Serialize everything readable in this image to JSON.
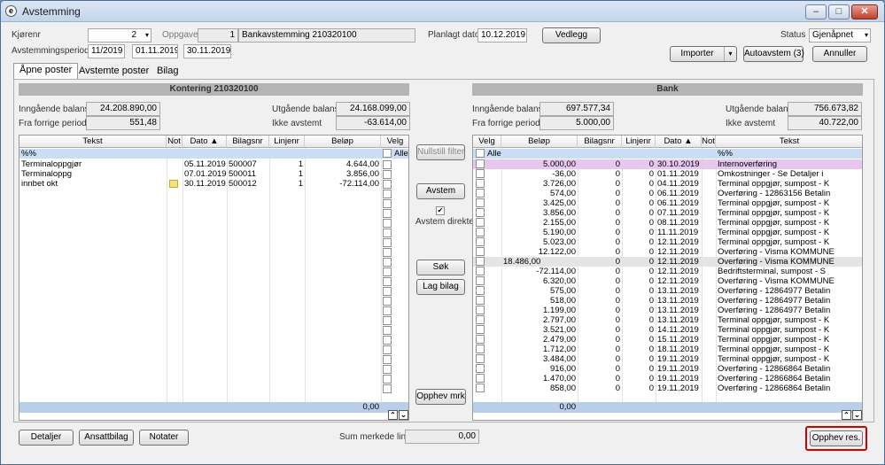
{
  "window": {
    "title": "Avstemming",
    "min": "–",
    "max": "□",
    "close": "✕"
  },
  "header": {
    "kjorenr_label": "Kjørenr",
    "kjorenr_value": "2",
    "oppgave_label": "Oppgave",
    "oppgave_num": "1",
    "oppgave_name": "Bankavstemming 210320100",
    "planlagt_label": "Planlagt dato",
    "planlagt_value": "10.12.2019",
    "vedlegg_button": "Vedlegg",
    "status_label": "Status",
    "status_value": "Gjenåpnet",
    "periode_label": "Avstemmingsperiode",
    "periode_value": "11/2019",
    "periode_from": "01.11.2019",
    "periode_to": "30.11.2019",
    "importer_button": "Importer",
    "autoavstem_button": "Autoavstem (3)",
    "annuller_button": "Annuller"
  },
  "tabs": [
    "Åpne poster",
    "Avstemte poster",
    "Bilag"
  ],
  "left": {
    "title": "Kontering 210320100",
    "ingaende_label": "Inngående balanse",
    "ingaende_value": "24.208.890,00",
    "utgaende_label": "Utgående balanse",
    "utgaende_value": "24.168.099,00",
    "forrige_label": "Fra forrige periode",
    "forrige_value": "551,48",
    "ikke_label": "Ikke avstemt",
    "ikke_value": "-63.614,00",
    "columns": [
      "Tekst",
      "Not",
      "Dato",
      "Bilagsnr",
      "Linjenr",
      "Beløp",
      "Velg"
    ],
    "filter": "%%",
    "alle": "Alle",
    "rows": [
      {
        "tekst": "Terminaloppgjør",
        "not": "",
        "dato": "05.11.2019",
        "bilagsnr": "500007",
        "linjenr": "1",
        "belop": "4.644,00"
      },
      {
        "tekst": "Terminaloppg",
        "not": "",
        "dato": "07.01.2019",
        "bilagsnr": "500011",
        "linjenr": "1",
        "belop": "3.856,00"
      },
      {
        "tekst": "innbet okt",
        "not": "note",
        "dato": "30.11.2019",
        "bilagsnr": "500012",
        "linjenr": "1",
        "belop": "-72.114,00"
      }
    ],
    "footer_sum": "0,00"
  },
  "middle": {
    "nullstill": "Nullstill filter",
    "avstem": "Avstem",
    "avstem_direkte": "Avstem direkte",
    "sok": "Søk",
    "lag_bilag": "Lag bilag",
    "opphev_mrk": "Opphev mrk"
  },
  "right": {
    "title": "Bank",
    "ingaende_label": "Inngående balanse",
    "ingaende_value": "697.577,34",
    "utgaende_label": "Utgående balanse",
    "utgaende_value": "756.673,82",
    "forrige_label": "Fra forrige periode",
    "forrige_value": "5.000,00",
    "ikke_label": "Ikke avstemt",
    "ikke_value": "40.722,00",
    "columns": [
      "Velg",
      "Beløp",
      "Bilagsnr",
      "Linjenr",
      "Dato",
      "Not",
      "Tekst"
    ],
    "filter": "%%",
    "alle": "Alle",
    "rows": [
      {
        "belop": "5.000,00",
        "bilagsnr": "0",
        "linjenr": "0",
        "dato": "30.10.2019",
        "tekst": "Internoverføring"
      },
      {
        "belop": "-36,00",
        "bilagsnr": "0",
        "linjenr": "0",
        "dato": "01.11.2019",
        "tekst": "Omkostninger - Se Detaljer i"
      },
      {
        "belop": "3.726,00",
        "bilagsnr": "0",
        "linjenr": "0",
        "dato": "04.11.2019",
        "tekst": "Terminal oppgjør, sumpost - K"
      },
      {
        "belop": "574,00",
        "bilagsnr": "0",
        "linjenr": "0",
        "dato": "06.11.2019",
        "tekst": "Overføring - 12863156 Betalin"
      },
      {
        "belop": "3.425,00",
        "bilagsnr": "0",
        "linjenr": "0",
        "dato": "06.11.2019",
        "tekst": "Terminal oppgjør, sumpost - K"
      },
      {
        "belop": "3.856,00",
        "bilagsnr": "0",
        "linjenr": "0",
        "dato": "07.11.2019",
        "tekst": "Terminal oppgjør, sumpost - K"
      },
      {
        "belop": "2.155,00",
        "bilagsnr": "0",
        "linjenr": "0",
        "dato": "08.11.2019",
        "tekst": "Terminal oppgjør, sumpost - K"
      },
      {
        "belop": "5.190,00",
        "bilagsnr": "0",
        "linjenr": "0",
        "dato": "11.11.2019",
        "tekst": "Terminal oppgjør, sumpost - K"
      },
      {
        "belop": "5.023,00",
        "bilagsnr": "0",
        "linjenr": "0",
        "dato": "12.11.2019",
        "tekst": "Terminal oppgjør, sumpost - K"
      },
      {
        "belop": "12.122,00",
        "bilagsnr": "0",
        "linjenr": "0",
        "dato": "12.11.2019",
        "tekst": "Overføring - Visma KOMMUNE"
      },
      {
        "belop": "18.486,00",
        "bilagsnr": "0",
        "linjenr": "0",
        "dato": "12.11.2019",
        "tekst": "Overføring - Visma KOMMUNE"
      },
      {
        "belop": "-72.114,00",
        "bilagsnr": "0",
        "linjenr": "0",
        "dato": "12.11.2019",
        "tekst": "Bedriftsterminal, sumpost - S"
      },
      {
        "belop": "6.320,00",
        "bilagsnr": "0",
        "linjenr": "0",
        "dato": "12.11.2019",
        "tekst": "Overføring - Visma KOMMUNE"
      },
      {
        "belop": "575,00",
        "bilagsnr": "0",
        "linjenr": "0",
        "dato": "13.11.2019",
        "tekst": "Overføring - 12864977 Betalin"
      },
      {
        "belop": "518,00",
        "bilagsnr": "0",
        "linjenr": "0",
        "dato": "13.11.2019",
        "tekst": "Overføring - 12864977 Betalin"
      },
      {
        "belop": "1.199,00",
        "bilagsnr": "0",
        "linjenr": "0",
        "dato": "13.11.2019",
        "tekst": "Overføring - 12864977 Betalin"
      },
      {
        "belop": "2.797,00",
        "bilagsnr": "0",
        "linjenr": "0",
        "dato": "13.11.2019",
        "tekst": "Terminal oppgjør, sumpost - K"
      },
      {
        "belop": "3.521,00",
        "bilagsnr": "0",
        "linjenr": "0",
        "dato": "14.11.2019",
        "tekst": "Terminal oppgjør, sumpost - K"
      },
      {
        "belop": "2.479,00",
        "bilagsnr": "0",
        "linjenr": "0",
        "dato": "15.11.2019",
        "tekst": "Terminal oppgjør, sumpost - K"
      },
      {
        "belop": "1.712,00",
        "bilagsnr": "0",
        "linjenr": "0",
        "dato": "18.11.2019",
        "tekst": "Terminal oppgjør, sumpost - K"
      },
      {
        "belop": "3.484,00",
        "bilagsnr": "0",
        "linjenr": "0",
        "dato": "19.11.2019",
        "tekst": "Terminal oppgjør, sumpost - K"
      },
      {
        "belop": "916,00",
        "bilagsnr": "0",
        "linjenr": "0",
        "dato": "19.11.2019",
        "tekst": "Overføring - 12866864 Betalin"
      },
      {
        "belop": "1.470,00",
        "bilagsnr": "0",
        "linjenr": "0",
        "dato": "19.11.2019",
        "tekst": "Overføring - 12866864 Betalin"
      },
      {
        "belop": "858,00",
        "bilagsnr": "0",
        "linjenr": "0",
        "dato": "19.11.2019",
        "tekst": "Overføring - 12866864 Betalin"
      }
    ],
    "footer_sum": "0,00"
  },
  "bottom": {
    "detaljer": "Detaljer",
    "ansattbilag": "Ansattbilag",
    "notater": "Notater",
    "sum_label": "Sum merkede linjer",
    "sum_value": "0,00",
    "opphev_res": "Opphev res."
  },
  "colors": {
    "filter_row": "#c9def4",
    "highlight_first": "#e7c6f0",
    "highlight_other": "#e4e4e4",
    "footer": "#b7cfe9",
    "callout": "#d40000"
  }
}
